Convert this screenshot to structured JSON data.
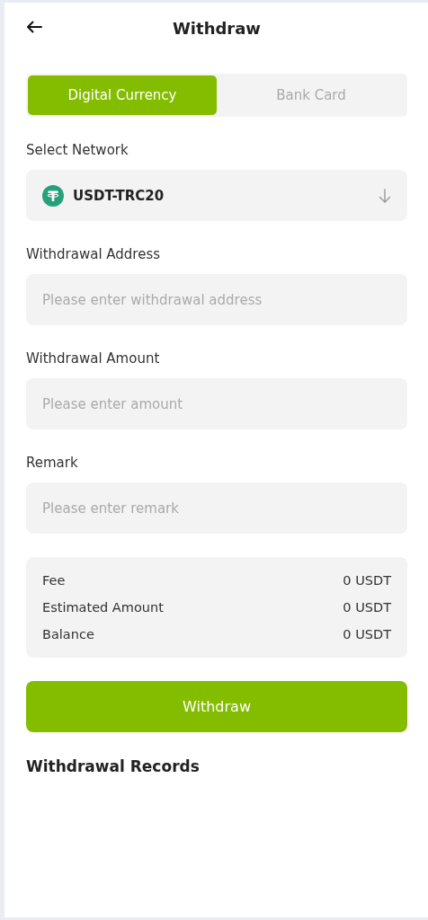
{
  "header": {
    "title": "Withdraw"
  },
  "tabs": [
    {
      "label": "Digital Currency",
      "selected": true
    },
    {
      "label": "Bank Card",
      "selected": false
    }
  ],
  "network": {
    "label": "Select Network",
    "value": "USDT-TRC20"
  },
  "fields": [
    {
      "label": "Withdrawal Address",
      "placeholder": "Please enter withdrawal address"
    },
    {
      "label": "Withdrawal Amount",
      "placeholder": "Please enter amount"
    },
    {
      "label": "Remark",
      "placeholder": "Please enter remark"
    }
  ],
  "summary": [
    {
      "label": "Fee",
      "value": "0 USDT"
    },
    {
      "label": "Estimated Amount",
      "value": "0 USDT"
    },
    {
      "label": "Balance",
      "value": "0 USDT"
    }
  ],
  "submit": "Withdraw",
  "records": {
    "title": "Withdrawal Records"
  }
}
